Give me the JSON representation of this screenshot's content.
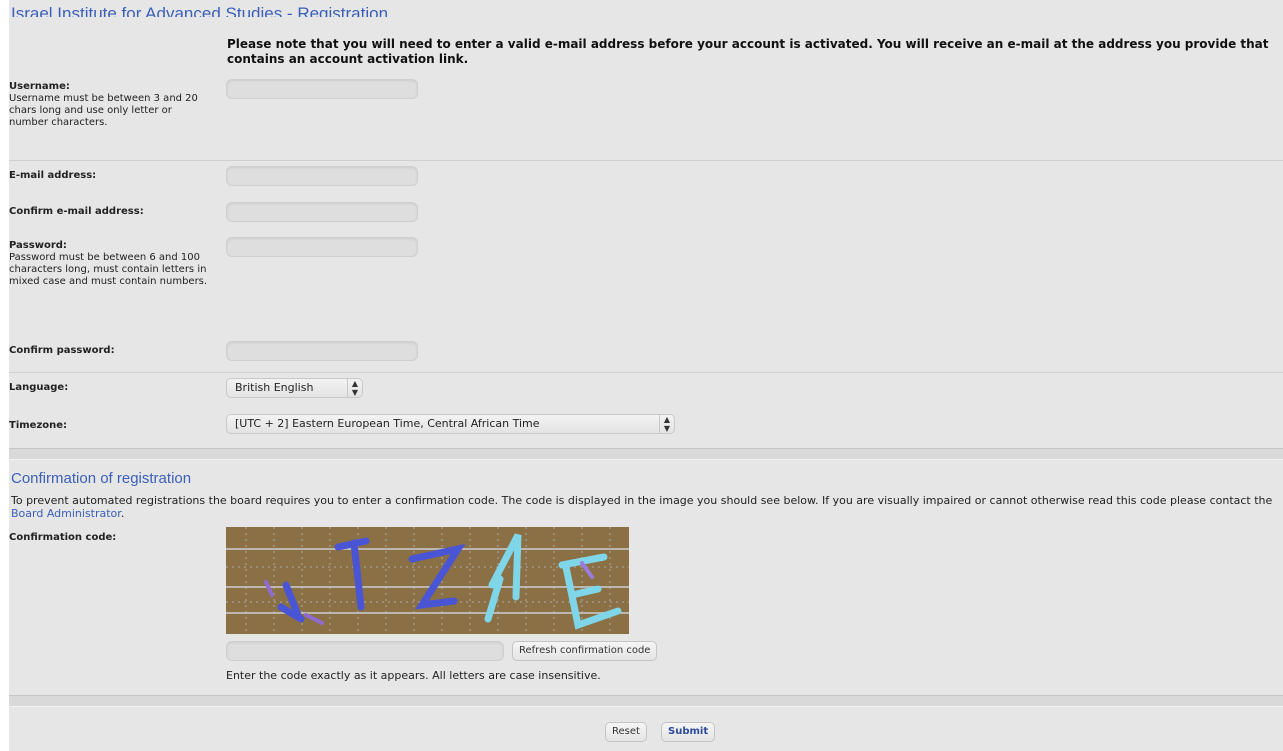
{
  "header": {
    "title": "Israel Institute for Advanced Studies - Registration",
    "notice": "Please note that you will need to enter a valid e-mail address before your account is activated. You will receive an e-mail at the address you provide that contains an account activation link."
  },
  "form": {
    "username": {
      "label": "Username:",
      "hint": "Username must be between 3 and 20 chars long and use only letter or number characters.",
      "value": ""
    },
    "email": {
      "label": "E-mail address:",
      "value": ""
    },
    "confirm_email": {
      "label": "Confirm e-mail address:",
      "value": ""
    },
    "password": {
      "label": "Password:",
      "hint": "Password must be between 6 and 100 characters long, must contain letters in mixed case and must contain numbers.",
      "value": ""
    },
    "confirm_password": {
      "label": "Confirm password:",
      "value": ""
    },
    "language": {
      "label": "Language:",
      "selected": "British English"
    },
    "timezone": {
      "label": "Timezone:",
      "selected": "[UTC + 2] Eastern European Time, Central African Time"
    }
  },
  "confirmation": {
    "title": "Confirmation of registration",
    "description": "To prevent automated registrations the board requires you to enter a confirmation code. The code is displayed in the image you should see below. If you are visually impaired or cannot otherwise read this code please contact the",
    "admin_link": "Board Administrator",
    "description_end": ".",
    "code_label": "Confirmation code:",
    "code_value": "",
    "refresh_button": "Refresh confirmation code",
    "help": "Enter the code exactly as it appears. All letters are case insensitive.",
    "captcha_colors": {
      "background": "#8a7044",
      "glyph_blue": "#4a55d6",
      "glyph_cyan": "#7fd6e8",
      "glyph_purple": "#8f6bd1"
    }
  },
  "actions": {
    "reset": "Reset",
    "submit": "Submit"
  }
}
